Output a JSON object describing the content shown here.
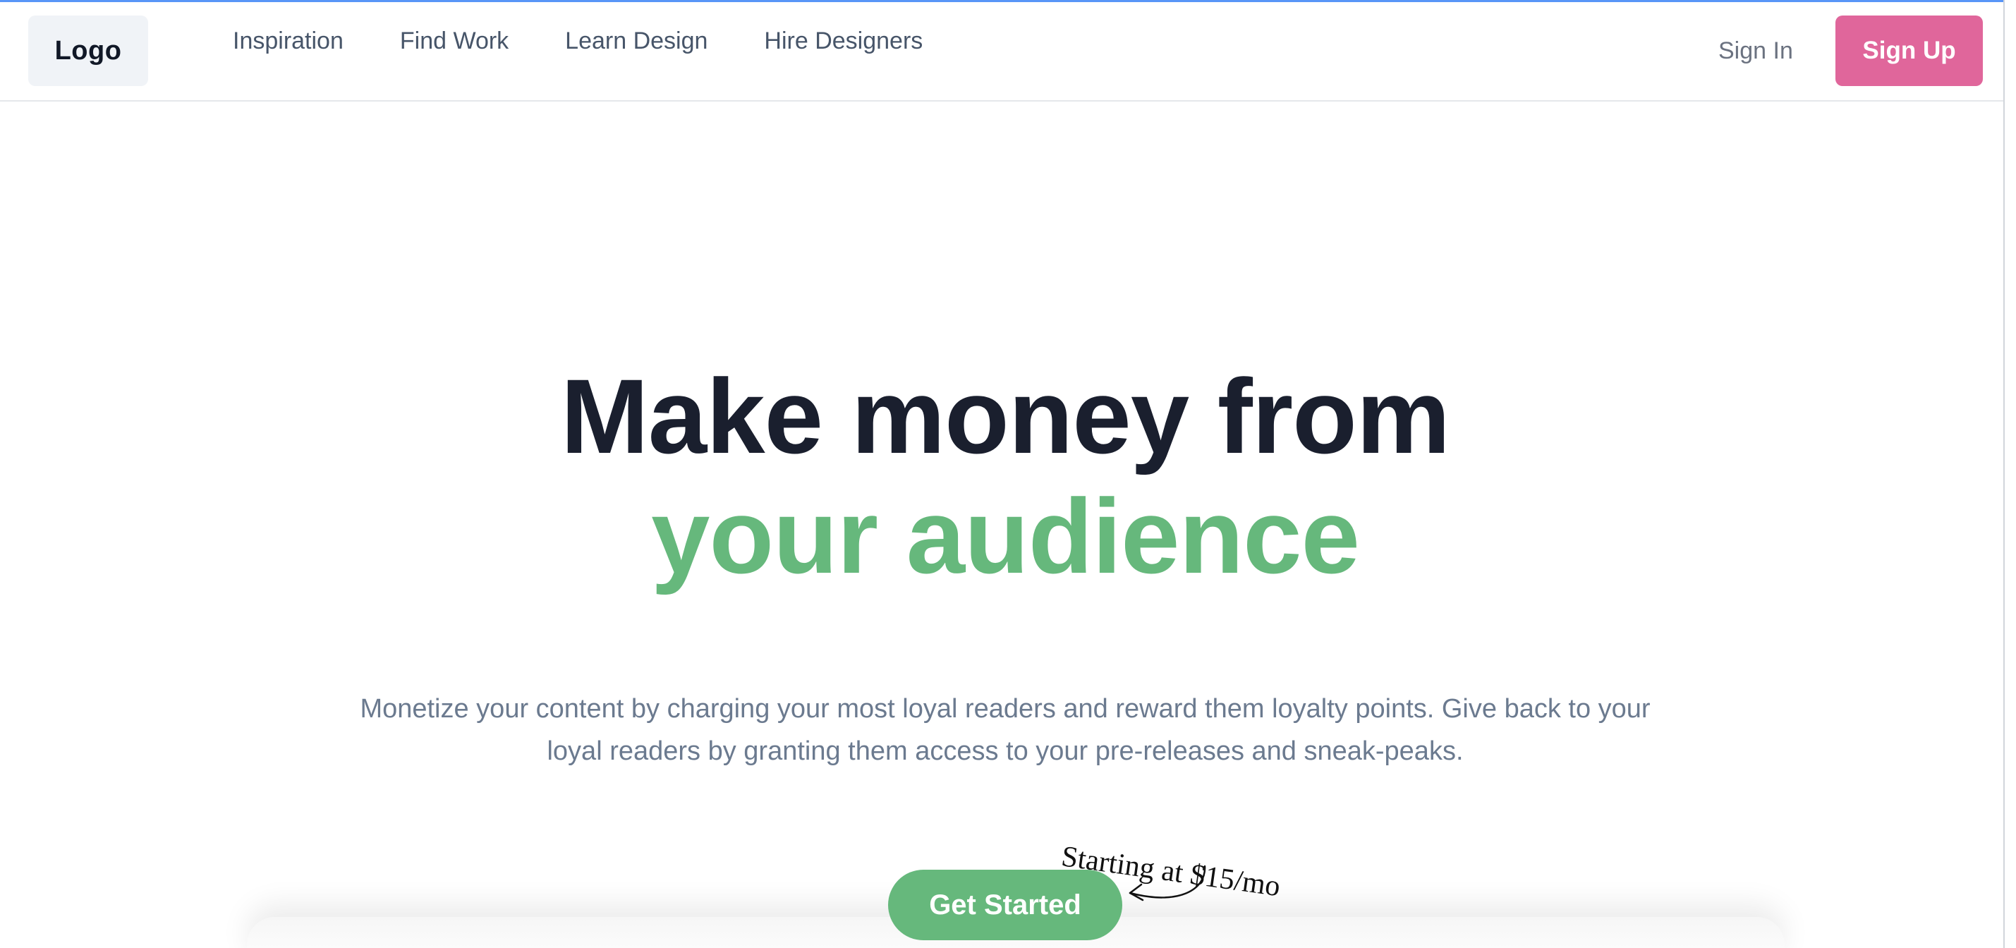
{
  "navbar": {
    "logo": "Logo",
    "links": [
      "Inspiration",
      "Find Work",
      "Learn Design",
      "Hire Designers"
    ],
    "sign_in": "Sign In",
    "sign_up": "Sign Up"
  },
  "hero": {
    "title_line1": "Make money from",
    "title_line2": "your audience",
    "subtitle": "Monetize your content by charging your most loyal readers and reward them loyalty points. Give back to your loyal readers by granting them access to your pre-releases and sneak-peaks.",
    "cta": "Get Started",
    "price_note": "Starting at $15/mo"
  },
  "colors": {
    "accent_green": "#66b87c",
    "accent_pink": "#e0669b",
    "heading": "#1a1f2e",
    "body_text": "#6b7a8f"
  },
  "icons": {
    "price_arrow": "curved-arrow-icon"
  }
}
